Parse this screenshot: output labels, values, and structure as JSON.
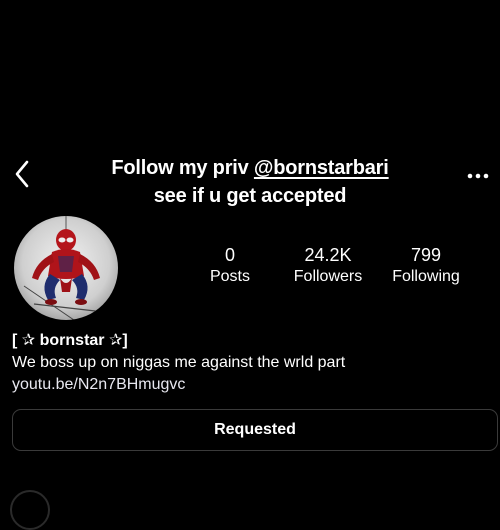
{
  "header": {
    "title_prefix": "Follow my priv ",
    "title_handle": "@bornstarbari",
    "title_line2": "see if u get accepted",
    "back_icon": "chevron-left-icon",
    "more_icon": "more-horizontal-icon"
  },
  "profile": {
    "avatar_icon": "profile-avatar",
    "stats": [
      {
        "value": "0",
        "label": "Posts"
      },
      {
        "value": "24.2K",
        "label": "Followers"
      },
      {
        "value": "799",
        "label": "Following"
      }
    ],
    "name": "[ ✰ bornstar ✰]",
    "bio": "We boss up on niggas me against the wrld part",
    "link": "youtu.be/N2n7BHmugvc"
  },
  "actions": {
    "requested_label": "Requested"
  },
  "colors": {
    "background": "#000000",
    "text": "#ffffff",
    "button_border": "#3a3a3a"
  }
}
